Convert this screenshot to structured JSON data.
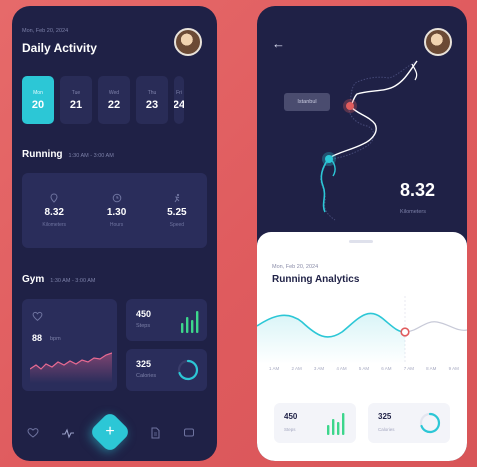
{
  "left": {
    "date": "Mon, Feb 20, 2024",
    "title": "Daily Activity",
    "days": [
      {
        "name": "Mon",
        "num": "20",
        "active": true
      },
      {
        "name": "Tue",
        "num": "21",
        "active": false
      },
      {
        "name": "Wed",
        "num": "22",
        "active": false
      },
      {
        "name": "Thu",
        "num": "23",
        "active": false
      },
      {
        "name": "Fri",
        "num": "24",
        "active": false
      }
    ],
    "running": {
      "title": "Running",
      "time": "1:30 AM - 3:00 AM",
      "stats": [
        {
          "value": "8.32",
          "label": "Kilometers",
          "icon": "location-pin-icon"
        },
        {
          "value": "1.30",
          "label": "Hours",
          "icon": "clock-icon"
        },
        {
          "value": "5.25",
          "label": "Speed",
          "icon": "run-icon"
        }
      ]
    },
    "gym": {
      "title": "Gym",
      "time": "1:30 AM - 3:00 AM",
      "heart_value": "88",
      "heart_unit": "bpm",
      "steps_value": "450",
      "steps_label": "Steps",
      "cal_value": "325",
      "cal_label": "Calories"
    }
  },
  "right": {
    "map_label": "Istanbul",
    "km_value": "8.32",
    "km_label": "Kilometers",
    "date": "Mon, Feb 20, 2024",
    "title": "Running Analytics",
    "times": [
      "1 AM",
      "2 AM",
      "3 AM",
      "4 AM",
      "5 AM",
      "6 AM",
      "7 AM",
      "8 AM",
      "9 AM"
    ],
    "steps_value": "450",
    "steps_label": "Steps",
    "cal_value": "325",
    "cal_label": "Calories"
  },
  "colors": {
    "accent": "#2cc7d6",
    "background": "#e05c5e",
    "dark": "#1f2146",
    "card": "#2a2d5b",
    "alert": "#e05c5e"
  }
}
